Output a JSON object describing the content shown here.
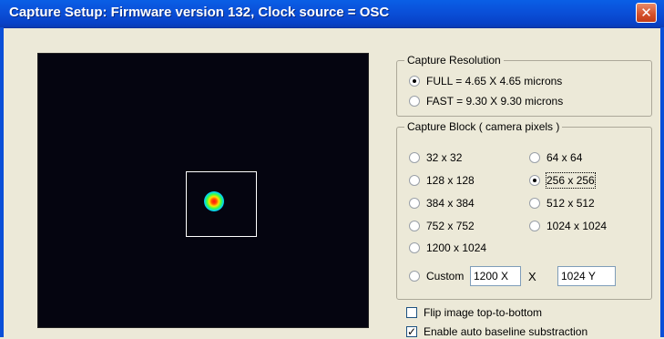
{
  "window": {
    "title": "Capture Setup: Firmware version 132,  Clock source = OSC",
    "close_glyph": "✕"
  },
  "resolution": {
    "legend": "Capture Resolution",
    "options": [
      {
        "label": "FULL = 4.65 X 4.65 microns",
        "selected": true
      },
      {
        "label": "FAST = 9.30 X 9.30 microns",
        "selected": false
      }
    ]
  },
  "block": {
    "legend": "Capture Block ( camera pixels )",
    "options": [
      {
        "label": "32 x 32",
        "selected": false
      },
      {
        "label": "64 x 64",
        "selected": false
      },
      {
        "label": "128 x 128",
        "selected": false
      },
      {
        "label": "256 x 256",
        "selected": true
      },
      {
        "label": "384 x 384",
        "selected": false
      },
      {
        "label": "512 x 512",
        "selected": false
      },
      {
        "label": "752 x 752",
        "selected": false
      },
      {
        "label": "1024 x 1024",
        "selected": false
      },
      {
        "label": "1200 x 1024",
        "selected": false
      }
    ],
    "custom": {
      "label": "Custom",
      "selected": false,
      "x_value": "1200 X",
      "separator": "X",
      "y_value": "1024 Y"
    }
  },
  "checkboxes": [
    {
      "label": "Flip image top-to-bottom",
      "checked": false
    },
    {
      "label": "Enable auto baseline substraction",
      "checked": true
    }
  ],
  "colors": {
    "title_bar": "#0a4fd8",
    "close_button": "#d4502a",
    "preview_background": "#050510",
    "dialog_background": "#ece9d8"
  }
}
